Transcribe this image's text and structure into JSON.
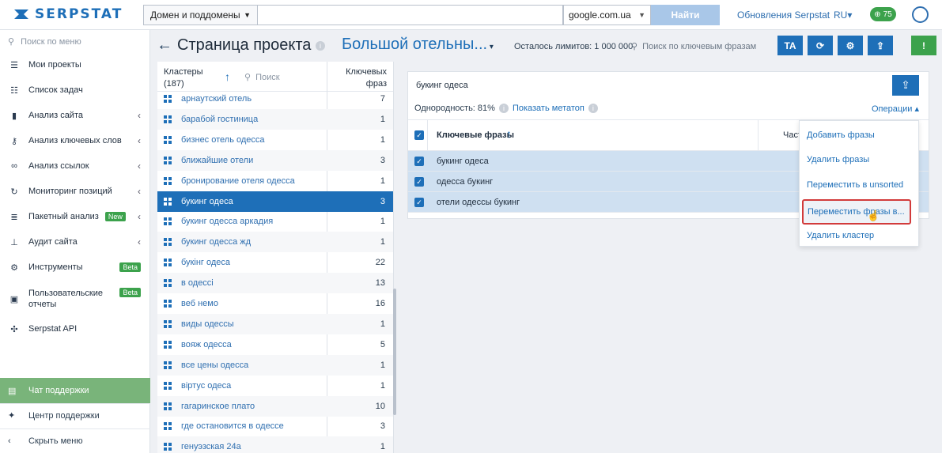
{
  "topbar": {
    "logo": "SERPSTAT",
    "domain_select": "Домен и поддомены",
    "search_value": "",
    "engine": "google.com.ua",
    "find_button": "Найти",
    "updates_link": "Обновления Serpstat",
    "lang": "RU",
    "credits": "75"
  },
  "sidebar": {
    "search_placeholder": "Поиск по меню",
    "items": [
      {
        "label": "Мои проекты"
      },
      {
        "label": "Список задач"
      },
      {
        "label": "Анализ сайта"
      },
      {
        "label": "Анализ ключевых слов"
      },
      {
        "label": "Анализ ссылок"
      },
      {
        "label": "Мониторинг позиций"
      },
      {
        "label": "Пакетный анализ",
        "badge": "New"
      },
      {
        "label": "Аудит сайта"
      },
      {
        "label": "Инструменты",
        "badge": "Beta"
      },
      {
        "label": "Пользовательские отчеты",
        "badge": "Beta"
      },
      {
        "label": "Serpstat API"
      }
    ],
    "chat_support": "Чат поддержки",
    "help_center": "Центр поддержки",
    "hide_menu": "Скрыть меню"
  },
  "header": {
    "title": "Страница проекта",
    "project": "Большой отельны...",
    "limits": "Осталось лимитов: 1 000 000",
    "kw_search_placeholder": "Поиск по ключевым фразам",
    "btn_ta": "TA"
  },
  "clusters": {
    "label": "Кластеры",
    "count": "(187)",
    "search_placeholder": "Поиск",
    "kw_header_1": "Ключевых",
    "kw_header_2": "фраз",
    "rows": [
      {
        "name": "арнаутский отель",
        "count": "7"
      },
      {
        "name": "барабой гостиница",
        "count": "1"
      },
      {
        "name": "бизнес отель одесса",
        "count": "1"
      },
      {
        "name": "ближайшие отели",
        "count": "3"
      },
      {
        "name": "бронирование отеля одесса",
        "count": "1"
      },
      {
        "name": "букинг одеса",
        "count": "3"
      },
      {
        "name": "букинг одесса аркадия",
        "count": "1"
      },
      {
        "name": "букинг одесса жд",
        "count": "1"
      },
      {
        "name": "букінг одеса",
        "count": "22"
      },
      {
        "name": "в одессі",
        "count": "13"
      },
      {
        "name": "веб немо",
        "count": "16"
      },
      {
        "name": "виды одессы",
        "count": "1"
      },
      {
        "name": "вояж одесса",
        "count": "5"
      },
      {
        "name": "все цены одесса",
        "count": "1"
      },
      {
        "name": "віртус одеса",
        "count": "1"
      },
      {
        "name": "гагаринское плато",
        "count": "10"
      },
      {
        "name": "где остановится в одессе",
        "count": "3"
      },
      {
        "name": "генуэзская 24а",
        "count": "1"
      }
    ]
  },
  "panel": {
    "title": "букинг одеса",
    "homogeneity": "Однородность: 81%",
    "show_metatags": "Показать метатоп",
    "operations": "Операции",
    "col_keywords": "Ключевые фразы",
    "col_freq": "Част",
    "keywords": [
      "букинг одеса",
      "одесса букинг",
      "отели одессы букинг"
    ]
  },
  "dropdown": {
    "items": [
      "Добавить фразы",
      "Удалить фразы",
      "Переместить в unsorted",
      "Переместить фразы в...",
      "Удалить кластер"
    ]
  },
  "colors": {
    "accent": "#1e6fb8",
    "green": "#3ca24c",
    "highlight_border": "#d23b3b"
  }
}
